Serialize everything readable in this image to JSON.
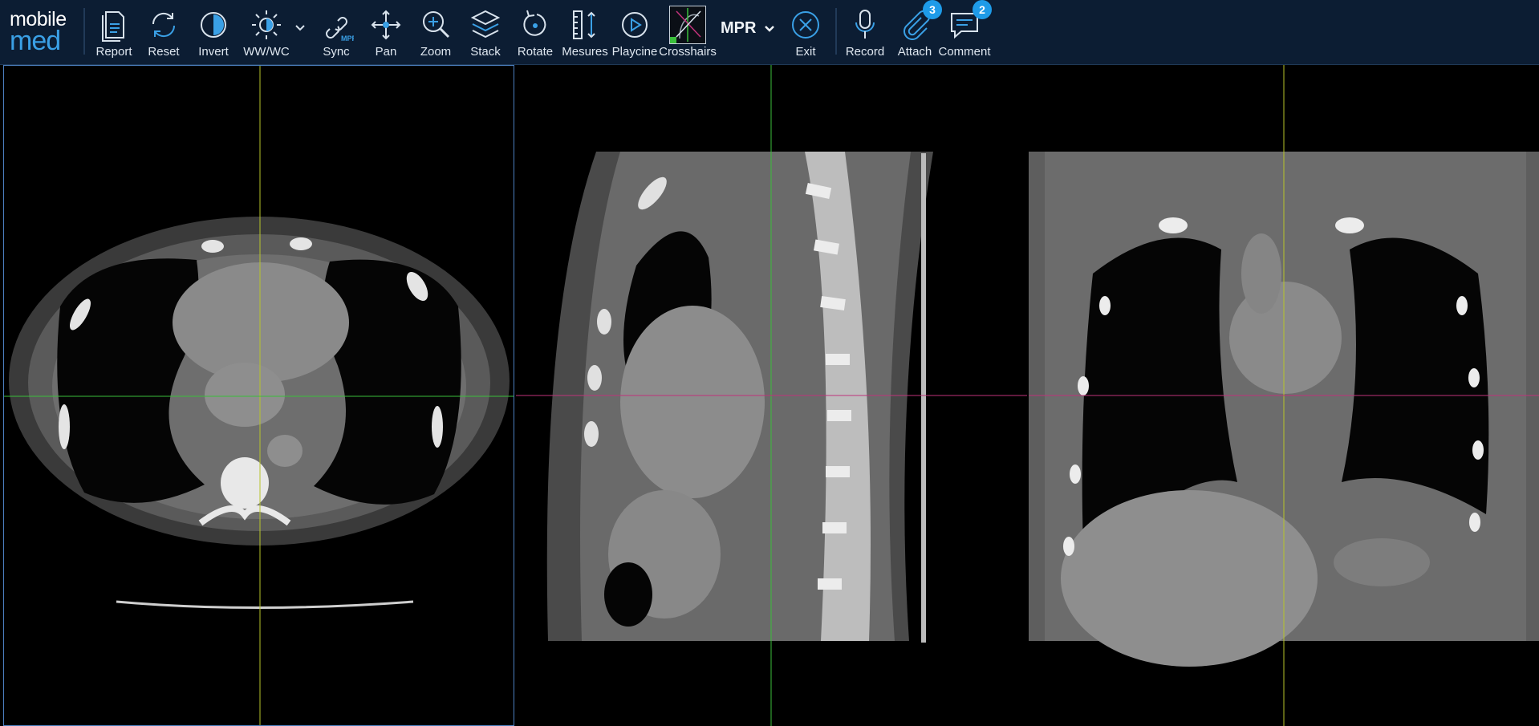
{
  "logo": {
    "line1": "mobile",
    "line2": "med"
  },
  "toolbar": {
    "report": "Report",
    "reset": "Reset",
    "invert": "Invert",
    "wwwc": "WW/WC",
    "sync": "Sync",
    "sync_badge": "MPR",
    "pan": "Pan",
    "zoom": "Zoom",
    "stack": "Stack",
    "rotate": "Rotate",
    "mesures": "Mesures",
    "playcine": "Playcine",
    "crosshairs": "Crosshairs",
    "layout_mode": "MPR",
    "exit": "Exit",
    "record": "Record",
    "attach": "Attach",
    "attach_count": "3",
    "comment": "Comment",
    "comment_count": "2"
  },
  "colors": {
    "toolbar_bg": "#0c1d33",
    "accent": "#3aa0e6",
    "badge": "#1e9be8",
    "crosshair_vertical": "#b7c42a",
    "crosshair_axial_h": "#3bbf3b",
    "crosshair_horizontal": "#c0327a",
    "viewport_border": "#4b7fbf"
  },
  "viewports": {
    "axial": "axial-ct-slice",
    "sagittal": "sagittal-ct-reconstruction",
    "coronal": "coronal-ct-reconstruction"
  }
}
